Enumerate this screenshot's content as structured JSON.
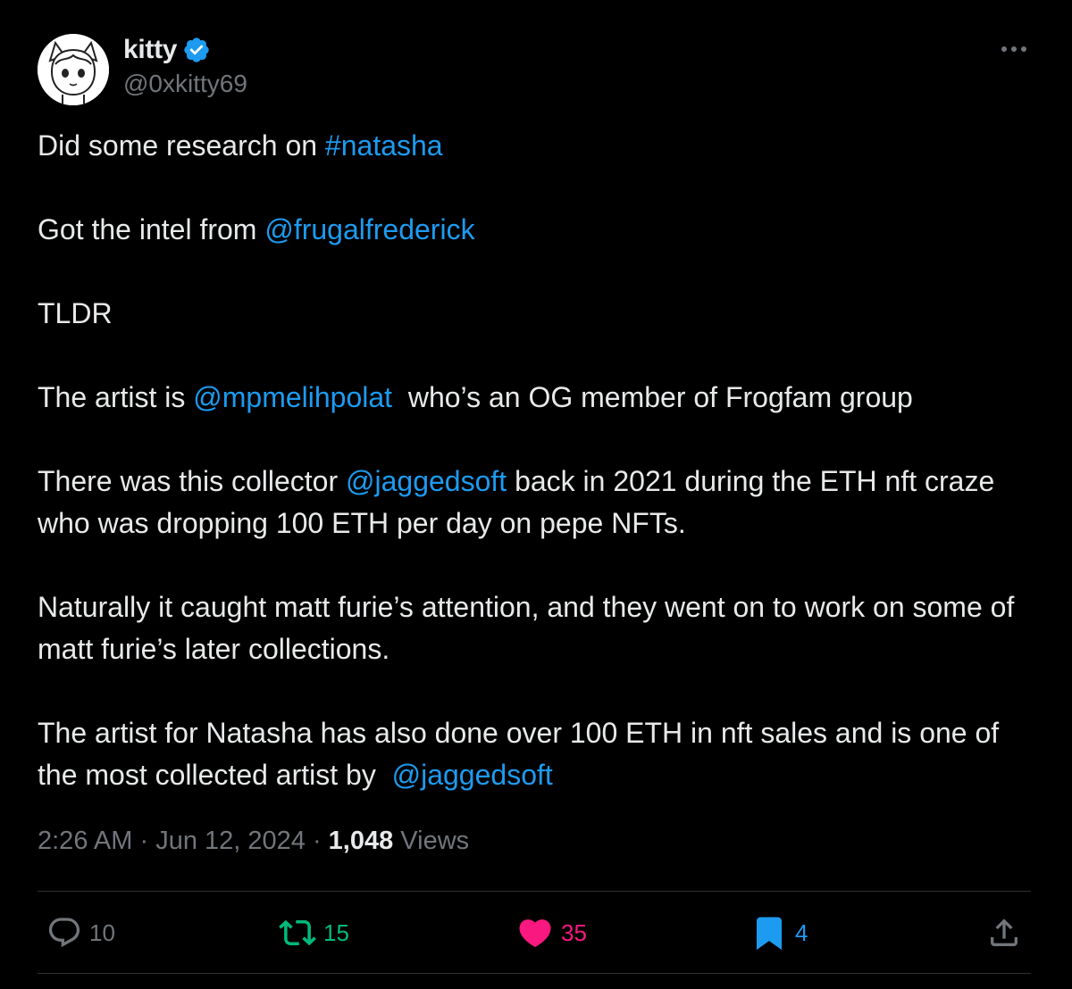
{
  "author": {
    "display_name": "kitty",
    "handle": "@0xkitty69",
    "verified": true
  },
  "more_icon": "more-horizontal-icon",
  "tweet": {
    "paragraphs": [
      [
        {
          "text": "Did some research on "
        },
        {
          "text": "#natasha",
          "link": true
        }
      ],
      [
        {
          "text": "Got the intel from "
        },
        {
          "text": "@frugalfrederick",
          "link": true
        }
      ],
      [
        {
          "text": "TLDR"
        }
      ],
      [
        {
          "text": "The artist is "
        },
        {
          "text": "@mpmelihpolat",
          "link": true
        },
        {
          "text": "  who’s an OG member of Frogfam group"
        }
      ],
      [
        {
          "text": "There was this collector "
        },
        {
          "text": "@jaggedsoft",
          "link": true
        },
        {
          "text": " back in 2021 during the ETH nft craze who was dropping 100 ETH per day on pepe NFTs."
        }
      ],
      [
        {
          "text": "Naturally it caught matt furie’s attention, and they went on to work on some of matt furie’s later collections."
        }
      ],
      [
        {
          "text": "The artist for Natasha has also done over 100 ETH in nft sales and is one of the most collected artist by  "
        },
        {
          "text": "@jaggedsoft",
          "link": true
        }
      ]
    ]
  },
  "meta": {
    "time": "2:26 AM",
    "separator": " · ",
    "date": "Jun 12, 2024",
    "views_count": "1,048",
    "views_label": " Views"
  },
  "actions": {
    "reply": {
      "icon": "reply-icon",
      "count": "10",
      "color": "#71767b"
    },
    "retweet": {
      "icon": "retweet-icon",
      "count": "15",
      "color": "#00ba7c"
    },
    "like": {
      "icon": "heart-icon",
      "count": "35",
      "color": "#f91880"
    },
    "bookmark": {
      "icon": "bookmark-icon",
      "count": "4",
      "color": "#1d9bf0"
    },
    "share": {
      "icon": "share-icon",
      "color": "#71767b"
    }
  },
  "colors": {
    "background": "#000000",
    "text": "#e7e9ea",
    "secondary": "#71767b",
    "link": "#1d9bf0",
    "verified": "#1d9bf0",
    "divider": "#2f3336"
  }
}
